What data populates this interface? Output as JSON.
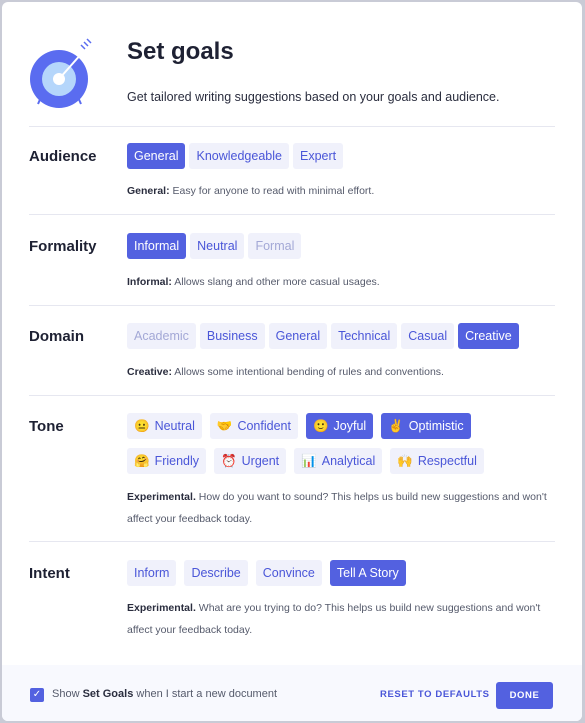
{
  "header": {
    "title": "Set goals",
    "subtitle": "Get tailored writing suggestions based on your goals and audience."
  },
  "colors": {
    "accent": "#5361e0",
    "option_bg": "#f0f1fb",
    "option_text": "#4a56d8"
  },
  "audience": {
    "label": "Audience",
    "options": [
      "General",
      "Knowledgeable",
      "Expert"
    ],
    "selected": "General",
    "desc_bold": "General:",
    "desc": " Easy for anyone to read with minimal effort."
  },
  "formality": {
    "label": "Formality",
    "options": [
      "Informal",
      "Neutral",
      "Formal"
    ],
    "selected": "Informal",
    "desc_bold": "Informal:",
    "desc": " Allows slang and other more casual usages."
  },
  "domain": {
    "label": "Domain",
    "options": [
      "Academic",
      "Business",
      "General",
      "Technical",
      "Casual",
      "Creative"
    ],
    "selected": "Creative",
    "desc_bold": "Creative:",
    "desc": " Allows some intentional bending of rules and conventions."
  },
  "tone": {
    "label": "Tone",
    "options": [
      {
        "emoji": "😐",
        "label": "Neutral"
      },
      {
        "emoji": "🤝",
        "label": "Confident"
      },
      {
        "emoji": "🙂",
        "label": "Joyful"
      },
      {
        "emoji": "✌️",
        "label": "Optimistic"
      },
      {
        "emoji": "🤗",
        "label": "Friendly"
      },
      {
        "emoji": "⏰",
        "label": "Urgent"
      },
      {
        "emoji": "📊",
        "label": "Analytical"
      },
      {
        "emoji": "🙌",
        "label": "Respectful"
      }
    ],
    "selected": [
      "Joyful",
      "Optimistic"
    ],
    "desc_bold": "Experimental.",
    "desc": " How do you want to sound? This helps us build new suggestions and won't affect your feedback today."
  },
  "intent": {
    "label": "Intent",
    "options": [
      "Inform",
      "Describe",
      "Convince",
      "Tell A Story"
    ],
    "selected": "Tell A Story",
    "desc_bold": "Experimental.",
    "desc": " What are you trying to do? This helps us build new suggestions and won't affect your feedback today."
  },
  "footer": {
    "checkbox_checked": true,
    "show_pre": "Show ",
    "show_bold": "Set Goals",
    "show_post": " when I start a new document",
    "reset": "RESET TO DEFAULTS",
    "done": "DONE"
  }
}
